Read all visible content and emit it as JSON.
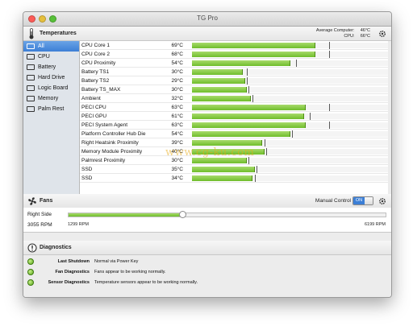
{
  "window": {
    "title": "TG Pro"
  },
  "temperatures_header": {
    "title": "Temperatures",
    "avg_computer_label": "Average Computer:",
    "avg_computer_value": "46°C",
    "cpu_label": "CPU:",
    "cpu_value": "66°C",
    "icon": "thermometer-icon"
  },
  "sidebar": {
    "items": [
      {
        "label": "All",
        "icon": "computer-icon",
        "selected": true
      },
      {
        "label": "CPU",
        "icon": "cpu-icon"
      },
      {
        "label": "Battery",
        "icon": "battery-icon"
      },
      {
        "label": "Hard Drive",
        "icon": "hard-drive-icon"
      },
      {
        "label": "Logic Board",
        "icon": "logic-board-icon"
      },
      {
        "label": "Memory",
        "icon": "memory-icon"
      },
      {
        "label": "Palm Rest",
        "icon": "palm-rest-icon"
      }
    ]
  },
  "sensors": [
    {
      "label": "CPU Core 1",
      "temp": "69°C",
      "level": 0.63,
      "max": 0.7
    },
    {
      "label": "CPU Core 2",
      "temp": "68°C",
      "level": 0.63,
      "max": 0.7
    },
    {
      "label": "CPU Proximity",
      "temp": "54°C",
      "level": 0.5,
      "max": 0.53
    },
    {
      "label": "Battery TS1",
      "temp": "30°C",
      "level": 0.26,
      "max": 0.28
    },
    {
      "label": "Battery TS2",
      "temp": "29°C",
      "level": 0.27,
      "max": 0.28
    },
    {
      "label": "Battery TS_MAX",
      "temp": "30°C",
      "level": 0.28,
      "max": 0.29
    },
    {
      "label": "Ambient",
      "temp": "32°C",
      "level": 0.3,
      "max": 0.31
    },
    {
      "label": "PECI CPU",
      "temp": "63°C",
      "level": 0.58,
      "max": 0.7
    },
    {
      "label": "PECI GPU",
      "temp": "61°C",
      "level": 0.57,
      "max": 0.6
    },
    {
      "label": "PECI System Agent",
      "temp": "63°C",
      "level": 0.58,
      "max": 0.7
    },
    {
      "label": "Platform Controller Hub Die",
      "temp": "54°C",
      "level": 0.5,
      "max": 0.51
    },
    {
      "label": "Right Heatsink Proximity",
      "temp": "39°C",
      "level": 0.36,
      "max": 0.37
    },
    {
      "label": "Memory Module Proximity",
      "temp": "40°C",
      "level": 0.37,
      "max": 0.38
    },
    {
      "label": "Palmrest Proximity",
      "temp": "30°C",
      "level": 0.28,
      "max": 0.29
    },
    {
      "label": "SSD",
      "temp": "35°C",
      "level": 0.32,
      "max": 0.33
    },
    {
      "label": "SSD",
      "temp": "34°C",
      "level": 0.31,
      "max": 0.32
    }
  ],
  "fans_header": {
    "title": "Fans",
    "icon": "fan-icon",
    "manual_control_label": "Manual Control",
    "toggle_on_label": "ON"
  },
  "fans": [
    {
      "name": "Right Side",
      "rpm": "3055 RPM",
      "min": "1299 RPM",
      "max": "6199 RPM",
      "level": 0.36
    }
  ],
  "diagnostics_header": {
    "title": "Diagnostics",
    "icon": "alert-icon"
  },
  "diagnostics": [
    {
      "label": "Last Shutdown",
      "message": "Normal via Power Key"
    },
    {
      "label": "Fan Diagnostics",
      "message": "Fans appear to be working normally."
    },
    {
      "label": "Sensor Diagnostics",
      "message": "Temperature sensors appear to be working normally."
    }
  ],
  "watermark": "www.cg-ku.com",
  "colors": {
    "bar_green": "#6fbd2b",
    "selection_blue": "#3c7fd6",
    "led_green": "#5aa81c"
  }
}
